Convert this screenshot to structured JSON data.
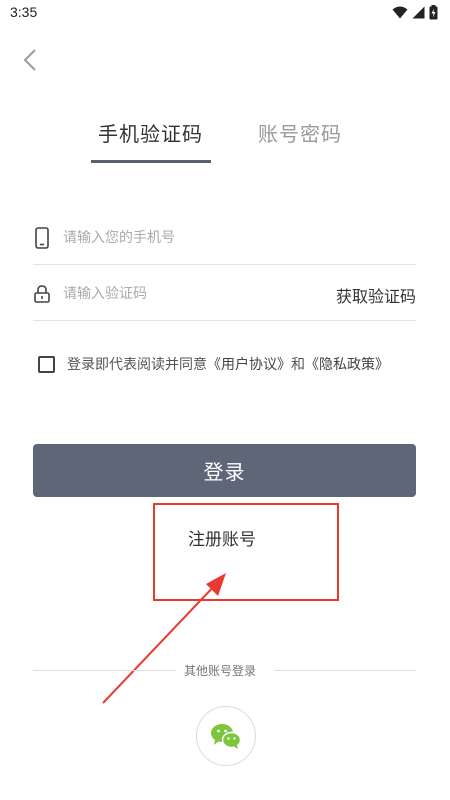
{
  "status_bar": {
    "time": "3:35",
    "icons": [
      "wifi-icon",
      "signal-icon",
      "battery-icon"
    ]
  },
  "header": {
    "back_icon": "chevron-left-icon"
  },
  "tabs": [
    {
      "label": "手机验证码",
      "active": true
    },
    {
      "label": "账号密码",
      "active": false
    }
  ],
  "form": {
    "phone": {
      "placeholder": "请输入您的手机号",
      "value": "",
      "icon": "phone-icon"
    },
    "code": {
      "placeholder": "请输入验证码",
      "value": "",
      "icon": "lock-icon",
      "get_code_label": "获取验证码"
    },
    "agreement": {
      "checked": false,
      "prefix": "登录即代表阅读并同意",
      "user_agreement": "《用户协议》",
      "conjunction": "和",
      "privacy_policy": "《隐私政策》"
    },
    "login_label": "登录",
    "register_label": "注册账号"
  },
  "other_login": {
    "label": "其他账号登录",
    "options": [
      {
        "icon": "wechat-icon"
      }
    ]
  },
  "colors": {
    "primary_button": "#5f6678",
    "tab_underline": "#5b6172",
    "annotation": "#e83a2e",
    "wechat": "#7bc63c"
  }
}
